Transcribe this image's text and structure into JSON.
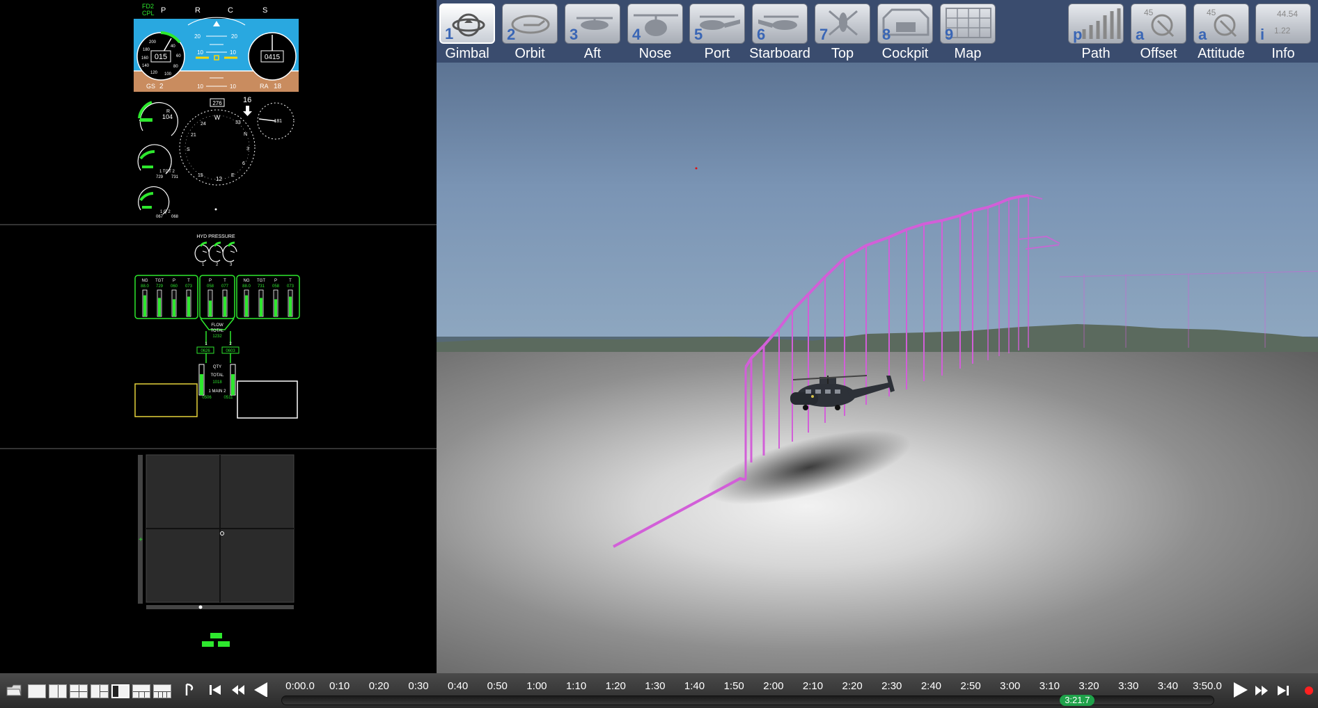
{
  "toolbar": {
    "camera_buttons": [
      {
        "key": "1",
        "label": "Gimbal",
        "icon": "gimbal-icon",
        "active": true
      },
      {
        "key": "2",
        "label": "Orbit",
        "icon": "orbit-icon"
      },
      {
        "key": "3",
        "label": "Aft",
        "icon": "helicopter-aft-icon"
      },
      {
        "key": "4",
        "label": "Nose",
        "icon": "helicopter-nose-icon"
      },
      {
        "key": "5",
        "label": "Port",
        "icon": "helicopter-port-icon"
      },
      {
        "key": "6",
        "label": "Starboard",
        "icon": "helicopter-starboard-icon"
      },
      {
        "key": "7",
        "label": "Top",
        "icon": "helicopter-top-icon"
      },
      {
        "key": "8",
        "label": "Cockpit",
        "icon": "cockpit-icon"
      },
      {
        "key": "9",
        "label": "Map",
        "icon": "map-grid-icon"
      }
    ],
    "overlay_buttons": [
      {
        "key": "p",
        "label": "Path",
        "icon": "path-icon"
      },
      {
        "key": "a",
        "label": "Offset",
        "icon": "offset-icon",
        "value": "45"
      },
      {
        "key": "a",
        "label": "Attitude",
        "icon": "attitude-icon",
        "value": "45"
      },
      {
        "key": "i",
        "label": "Info",
        "icon": "info-icon",
        "value": "44.54"
      }
    ]
  },
  "pfd": {
    "mode_top": "FD2",
    "mode_bottom": "CPL",
    "modes": [
      "P",
      "R",
      "C",
      "S"
    ],
    "pitch_scale": [
      "20",
      "10",
      "10",
      "10",
      "10"
    ],
    "speed": "015",
    "altitude": "0415",
    "gs_label": "GS",
    "gs_value": "2",
    "ra_label": "RA",
    "ra_value": "18",
    "speed_ticks": [
      "200",
      "40",
      "60",
      "80",
      "100",
      "120",
      "140",
      "160",
      "180"
    ],
    "heading_box": "276",
    "heading_numbers": [
      "W",
      "33",
      "N",
      "3",
      "6",
      "E",
      "12",
      "15",
      "S",
      "21",
      "24"
    ],
    "torque_label": "R",
    "torque_value": "104",
    "tgt_label": "1 TGT 2",
    "tgt_values": [
      "729",
      "731"
    ],
    "ng_label": "1  Q  2",
    "ng_values": [
      "067",
      "068"
    ],
    "wind_value": "16",
    "vsi_value": "-181"
  },
  "engine": {
    "hyd_title": "HYD PRESSURE",
    "hyd_numbers": [
      "1",
      "2",
      "3"
    ],
    "left_group": [
      {
        "label": "NG",
        "value": "88.0",
        "fill": 0.8
      },
      {
        "label": "TGT",
        "value": "729",
        "fill": 0.7
      },
      {
        "label": "P",
        "value": "060",
        "fill": 0.65
      },
      {
        "label": "T",
        "value": "073",
        "fill": 0.75
      }
    ],
    "mid_group": [
      {
        "label": "P",
        "value": "058",
        "fill": 0.6
      },
      {
        "label": "T",
        "value": "077",
        "fill": 0.75
      }
    ],
    "right_group": [
      {
        "label": "NG",
        "value": "88.0",
        "fill": 0.8
      },
      {
        "label": "TGT",
        "value": "731",
        "fill": 0.7
      },
      {
        "label": "P",
        "value": "058",
        "fill": 0.65
      },
      {
        "label": "T",
        "value": "073",
        "fill": 0.75
      }
    ],
    "flow_label": "FLOW",
    "flow_total_label": "TOTAL",
    "flow_total_value": "1232",
    "flow_tank_labels": [
      "1",
      "2"
    ],
    "flow_tank_values": [
      "0626",
      "0603"
    ],
    "qty_label": "QTY",
    "qty_total_label": "TOTAL",
    "qty_total_value": "1018",
    "main_label": "1 MAIN 2",
    "main_values": [
      "0506",
      "0511"
    ]
  },
  "timeline": {
    "ticks": [
      "0:00.0",
      "0:10",
      "0:20",
      "0:30",
      "0:40",
      "0:50",
      "1:00",
      "1:10",
      "1:20",
      "1:30",
      "1:40",
      "1:50",
      "2:00",
      "2:10",
      "2:20",
      "2:30",
      "2:40",
      "2:50",
      "3:00",
      "3:10",
      "3:20",
      "3:30",
      "3:40",
      "3:50.0"
    ],
    "current": "3:21.7",
    "current_fraction": 0.8567
  },
  "colors": {
    "toolbar_bg": "#3a4c6e",
    "key_blue": "#3a66b5",
    "path_magenta": "#d25fd8",
    "gauge_green": "#2ee82e",
    "sky_blue": "#29a8e0",
    "ground_brown": "#c98c5f",
    "badge_green": "#1fa24a"
  }
}
